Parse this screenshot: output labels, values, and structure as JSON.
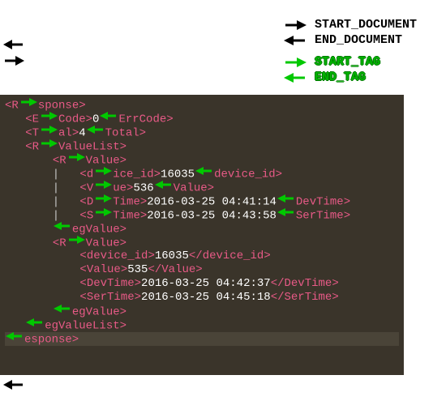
{
  "legend": {
    "start_document": "START_DOCUMENT",
    "end_document": "END_DOCUMENT",
    "start_tag": "START_TAG",
    "end_tag": "END_TAG"
  },
  "xml": {
    "tags": {
      "response": "Response",
      "err_code": "ErrCode",
      "total": "Total",
      "reg_value_list": "RegValueList",
      "reg_value": "RegValue",
      "device_id": "device_id",
      "value": "Value",
      "dev_time": "DevTime",
      "ser_time": "SerTime"
    },
    "err_code": "0",
    "total": "4",
    "records": [
      {
        "device_id": "16035",
        "value": "536",
        "dev_time": "2016-03-25 04:41:14",
        "ser_time": "2016-03-25 04:43:58"
      },
      {
        "device_id": "16035",
        "value": "535",
        "dev_time": "2016-03-25 04:42:37",
        "ser_time": "2016-03-25 04:45:18"
      }
    ]
  }
}
